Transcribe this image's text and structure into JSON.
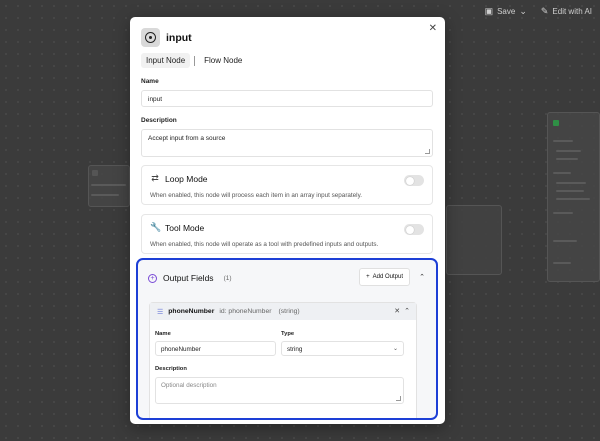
{
  "toolbar": {
    "save_label": "Save",
    "edit_label": "Edit with AI"
  },
  "modal": {
    "title": "input",
    "tabs": [
      {
        "label": "Input Node",
        "active": true
      },
      {
        "label": "Flow Node",
        "active": false
      }
    ],
    "name_label": "Name",
    "name_value": "input",
    "description_label": "Description",
    "description_value": "Accept input from a source",
    "loop_mode": {
      "title": "Loop Mode",
      "description": "When enabled, this node will process each item in an array input separately.",
      "enabled": false
    },
    "tool_mode": {
      "title": "Tool Mode",
      "description": "When enabled, this node will operate as a tool with predefined inputs and outputs.",
      "enabled": false
    },
    "output_fields": {
      "title": "Output Fields",
      "count": "(1)",
      "add_label": "Add Output",
      "fields": [
        {
          "name": "phoneNumber",
          "id_text": "id: phoneNumber",
          "type_text": "(string)",
          "name_label": "Name",
          "name_value": "phoneNumber",
          "type_label": "Type",
          "type_value": "string",
          "description_label": "Description",
          "description_placeholder": "Optional description"
        }
      ]
    }
  },
  "colors": {
    "accent_border": "#1d3fd6",
    "accent_purple": "#7a4bd6"
  }
}
